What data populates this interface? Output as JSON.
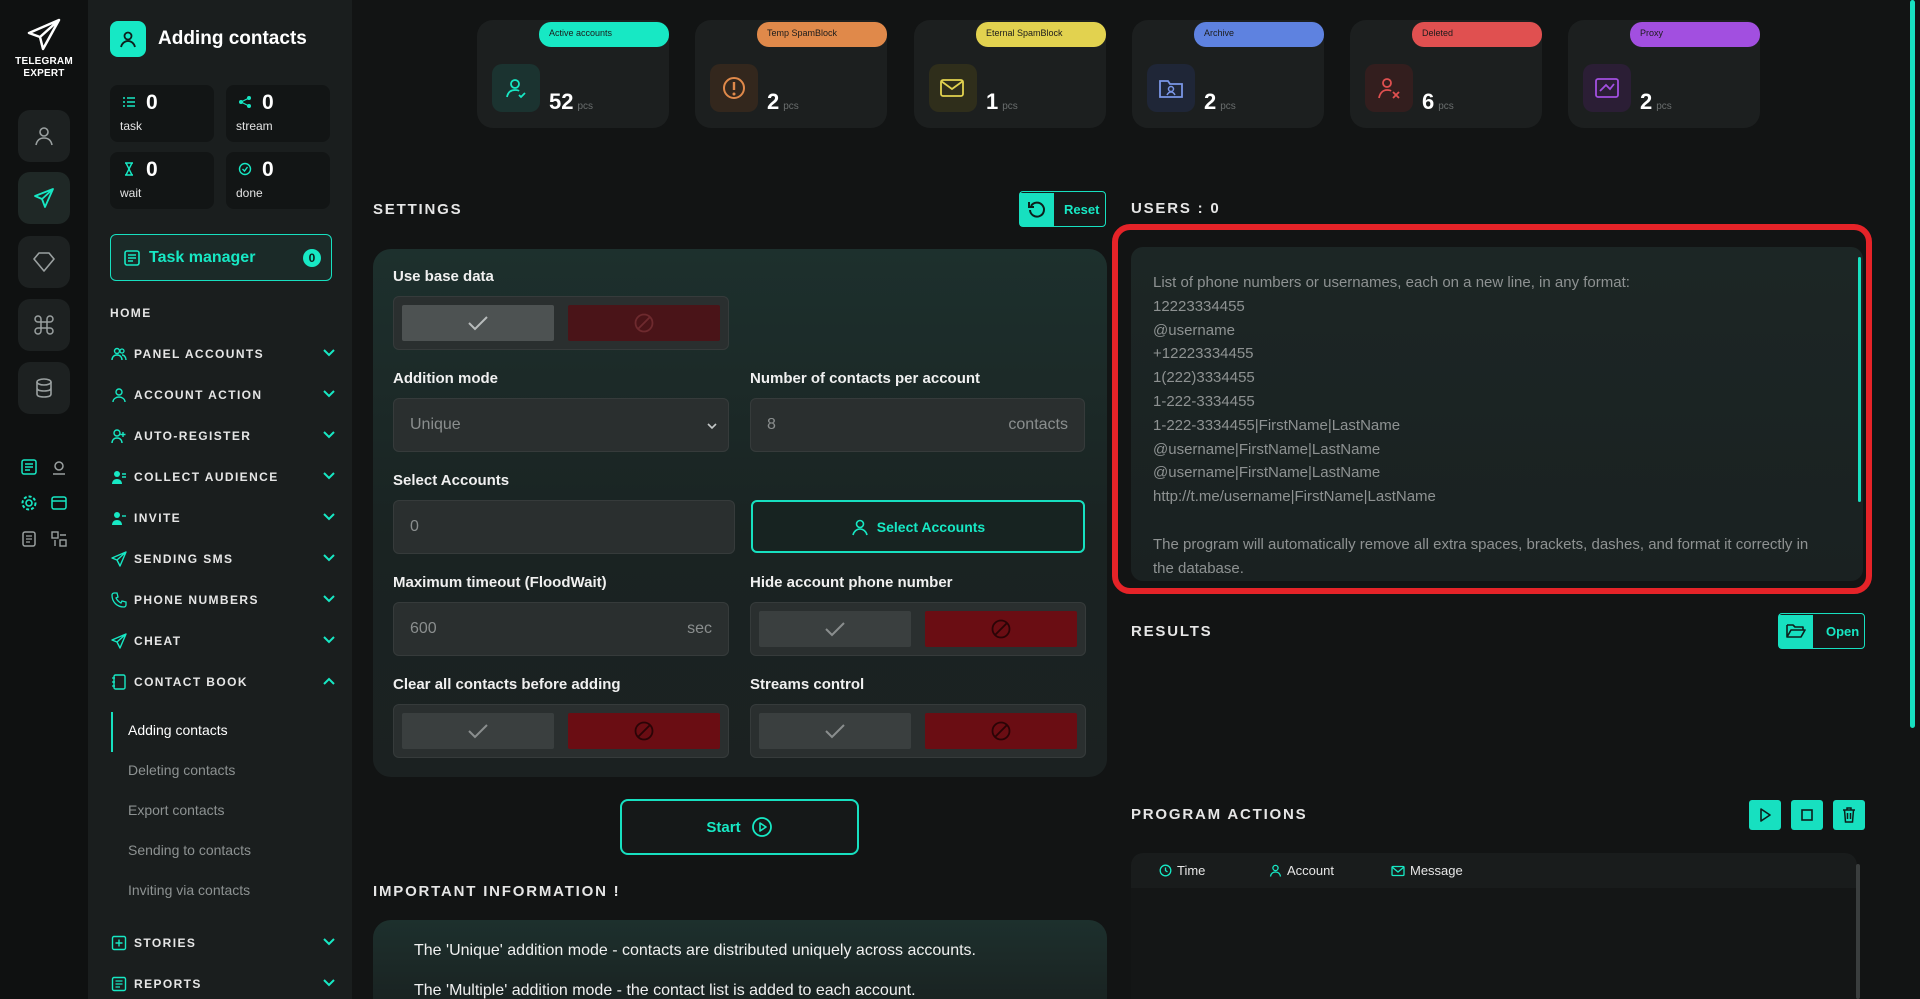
{
  "app": {
    "logo_line1": "TELEGRAM",
    "logo_line2": "EXPERT"
  },
  "header": {
    "title": "Adding contacts"
  },
  "stats": [
    {
      "value": "0",
      "label": "task"
    },
    {
      "value": "0",
      "label": "stream"
    },
    {
      "value": "0",
      "label": "wait"
    },
    {
      "value": "0",
      "label": "done"
    }
  ],
  "task_manager": {
    "label": "Task manager",
    "count": "0"
  },
  "nav": {
    "home": "HOME",
    "items": [
      "PANEL ACCOUNTS",
      "ACCOUNT ACTION",
      "AUTO-REGISTER",
      "COLLECT AUDIENCE",
      "INVITE",
      "SENDING SMS",
      "PHONE NUMBERS",
      "CHEAT",
      "CONTACT BOOK",
      "STORIES",
      "REPORTS"
    ],
    "contact_book_sub": [
      "Adding contacts",
      "Deleting contacts",
      "Export contacts",
      "Sending to contacts",
      "Inviting via contacts"
    ]
  },
  "cards": [
    {
      "label": "Active accounts",
      "value": "52",
      "unit": "pcs",
      "color": "#17e8c4"
    },
    {
      "label": "Temp SpamBlock",
      "value": "2",
      "unit": "pcs",
      "color": "#e0894a"
    },
    {
      "label": "Eternal SpamBlock",
      "value": "1",
      "unit": "pcs",
      "color": "#e2d24f"
    },
    {
      "label": "Archive",
      "value": "2",
      "unit": "pcs",
      "color": "#5e82e0"
    },
    {
      "label": "Deleted",
      "value": "6",
      "unit": "pcs",
      "color": "#e05050"
    },
    {
      "label": "Proxy",
      "value": "2",
      "unit": "pcs",
      "color": "#a24fe0"
    }
  ],
  "settings": {
    "title": "SETTINGS",
    "reset_label": "Reset",
    "use_base_data": "Use base data",
    "addition_mode": {
      "label": "Addition mode",
      "value": "Unique"
    },
    "contacts_per_account": {
      "label": "Number of contacts per account",
      "placeholder": "8",
      "suffix": "contacts"
    },
    "select_accounts": {
      "label": "Select Accounts",
      "value": "0",
      "button": "Select Accounts"
    },
    "max_timeout": {
      "label": "Maximum timeout (FloodWait)",
      "placeholder": "600",
      "suffix": "sec"
    },
    "hide_phone": "Hide account phone number",
    "clear_contacts": "Clear all contacts before adding",
    "streams_control": "Streams control"
  },
  "start_label": "Start",
  "important": {
    "title": "IMPORTANT INFORMATION !",
    "lines": [
      "The 'Unique' addition mode - contacts are distributed uniquely across accounts.",
      "The 'Multiple' addition mode - the contact list is added to each account."
    ]
  },
  "users": {
    "title": "USERS : 0",
    "placeholder_lines": [
      "List of phone numbers or usernames, each on a new line, in any format:",
      "12223334455",
      "@username",
      "+12223334455",
      "1(222)3334455",
      "1-222-3334455",
      "1-222-3334455|FirstName|LastName",
      "@username|FirstName|LastName",
      "@username|FirstName|LastName",
      "http://t.me/username|FirstName|LastName",
      ""
    ],
    "note": "The program will automatically remove all extra spaces, brackets, dashes, and format it correctly in the database."
  },
  "results": {
    "title": "RESULTS",
    "open_label": "Open"
  },
  "program_actions": {
    "title": "PROGRAM ACTIONS",
    "columns": [
      "Time",
      "Account",
      "Message"
    ]
  }
}
